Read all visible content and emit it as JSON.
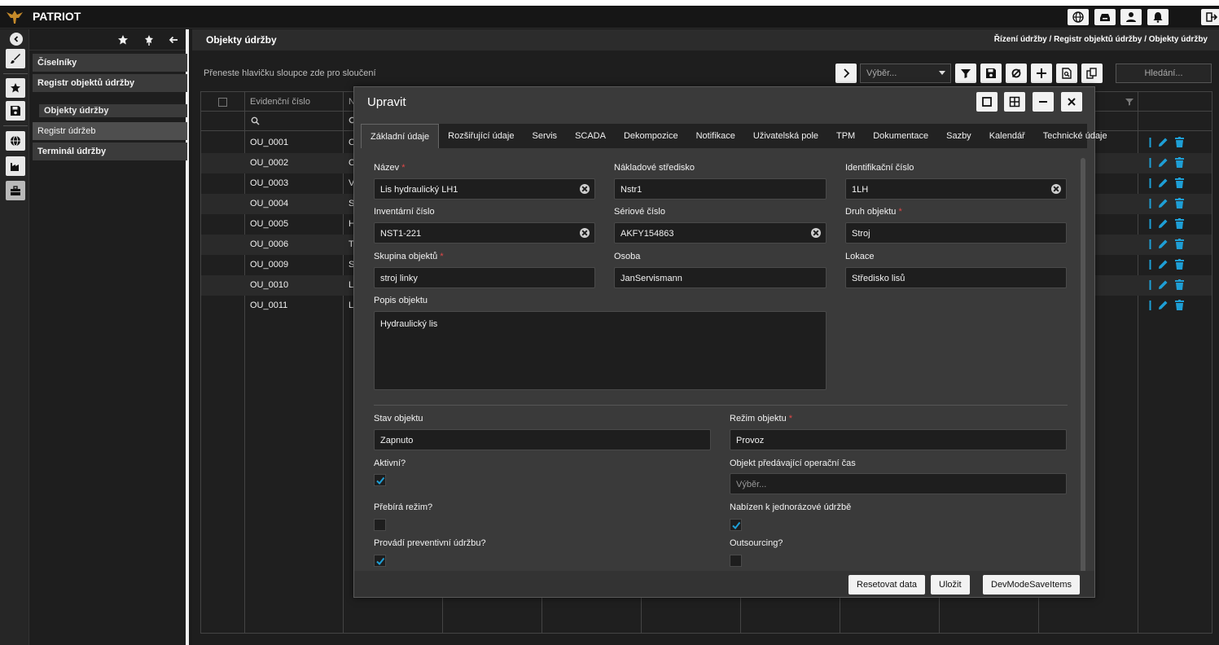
{
  "app": {
    "title": "PATRIOT"
  },
  "sidebar": {
    "items": [
      {
        "label": "Číselníky"
      },
      {
        "label": "Registr objektů údržby"
      }
    ],
    "sub_item": "Objekty údržby",
    "active_item": "Registr údržeb",
    "terminal": "Terminál údržby"
  },
  "main": {
    "title": "Objekty údržby",
    "breadcrumb": "Řízení údržby / Registr objektů údržby / Objekty údržby",
    "group_hint": "Přeneste hlavičku sloupce zde pro sloučení",
    "select_placeholder": "Výběr...",
    "search_placeholder": "Hledání..."
  },
  "grid": {
    "columns": [
      "",
      "Evidenční číslo",
      "N"
    ],
    "rows": [
      {
        "id": "OU_0001",
        "n": "O"
      },
      {
        "id": "OU_0002",
        "n": "O"
      },
      {
        "id": "OU_0003",
        "n": "V"
      },
      {
        "id": "OU_0004",
        "n": "S"
      },
      {
        "id": "OU_0005",
        "n": "H"
      },
      {
        "id": "OU_0006",
        "n": "T"
      },
      {
        "id": "OU_0009",
        "n": "S"
      },
      {
        "id": "OU_0010",
        "n": "L"
      },
      {
        "id": "OU_0011",
        "n": "L"
      }
    ]
  },
  "modal": {
    "title": "Upravit",
    "tabs": [
      "Základní údaje",
      "Rozšiřující údaje",
      "Servis",
      "SCADA",
      "Dekompozice",
      "Notifikace",
      "Uživatelská pole",
      "TPM",
      "Dokumentace",
      "Sazby",
      "Kalendář",
      "Technické údaje"
    ],
    "fields": {
      "nazev": {
        "label": "Název",
        "value": "Lis hydraulický LH1"
      },
      "nakladove": {
        "label": "Nákladové středisko",
        "value": "Nstr1"
      },
      "identifikacni": {
        "label": "Identifikační číslo",
        "value": "1LH"
      },
      "inventarni": {
        "label": "Inventární číslo",
        "value": "NST1-221"
      },
      "seriove": {
        "label": "Sériové číslo",
        "value": "AKFY154863"
      },
      "druh": {
        "label": "Druh objektu",
        "value": "Stroj"
      },
      "skupina": {
        "label": "Skupina objektů",
        "value": "stroj linky"
      },
      "osoba": {
        "label": "Osoba",
        "value": "JanServismann"
      },
      "lokace": {
        "label": "Lokace",
        "value": "Středisko lisů"
      },
      "popis": {
        "label": "Popis objektu",
        "value": "Hydraulický lis"
      },
      "stav": {
        "label": "Stav objektu",
        "value": "Zapnuto"
      },
      "rezim": {
        "label": "Režim objektu",
        "value": "Provoz"
      },
      "aktivni": {
        "label": "Aktivní?",
        "checked": true
      },
      "objekt_cas": {
        "label": "Objekt předávající operační čas",
        "placeholder": "Výběr..."
      },
      "prebira": {
        "label": "Přebírá režim?",
        "checked": false
      },
      "nabizen": {
        "label": "Nabízen k jednorázové údržbě",
        "checked": true
      },
      "provadi": {
        "label": "Provádí preventivní údržbu?",
        "checked": true
      },
      "outsourcing": {
        "label": "Outsourcing?",
        "checked": false
      }
    },
    "buttons": {
      "reset": "Resetovat data",
      "save": "Uložit",
      "dev": "DevModeSaveItems"
    }
  },
  "colors": {
    "accent": "#1e9fd6",
    "required": "#e04848",
    "background": "#1c1c1c"
  }
}
